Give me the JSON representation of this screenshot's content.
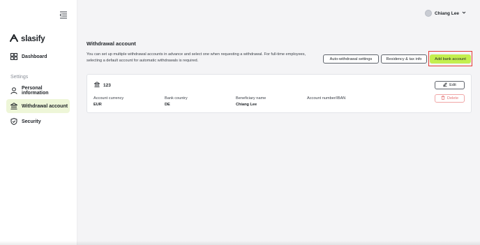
{
  "brand": {
    "name": "slasify"
  },
  "sidebar": {
    "items": [
      {
        "label": "Dashboard",
        "icon": "dashboard-icon"
      },
      {
        "label": "Personal information",
        "icon": "user-icon"
      },
      {
        "label": "Withdrawal account",
        "icon": "bank-icon"
      },
      {
        "label": "Security",
        "icon": "shield-icon"
      }
    ],
    "section_label": "Settings"
  },
  "header": {
    "user_name": "Chiang Lee"
  },
  "main": {
    "title": "Withdrawal account",
    "description": "You can set up multiple withdrawal accounts in advance and select one when requesting a withdrawal. For full-time employees, selecting a default account for automatic withdrawals is required.",
    "buttons": {
      "auto_withdrawal": "Auto-withdrawal settings",
      "residency": "Residency & tax info",
      "add_bank": "Add bank account"
    }
  },
  "account": {
    "name": "123",
    "fields": [
      {
        "label": "Account currency",
        "value": "EUR"
      },
      {
        "label": "Bank country",
        "value": "DE"
      },
      {
        "label": "Beneficiary name",
        "value": "Chiang Lee"
      },
      {
        "label": "Account number/IBAN",
        "value": ""
      }
    ],
    "edit_label": "Edit",
    "delete_label": "Delete"
  },
  "colors": {
    "accent": "#c3ef4f",
    "active_nav": "#eef6d8",
    "danger": "#e57373",
    "highlight": "#e53935"
  }
}
